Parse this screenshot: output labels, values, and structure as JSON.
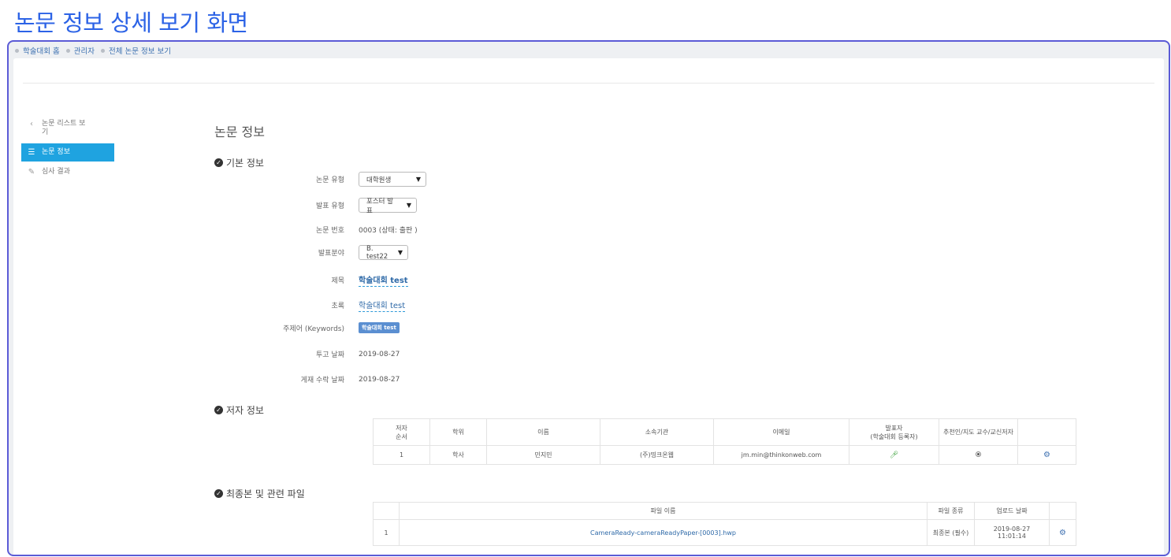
{
  "page_heading": "논문 정보 상세 보기 화면",
  "breadcrumb": [
    "학술대회 홈",
    "관리자",
    "전체 논문 정보 보기"
  ],
  "sidebar": {
    "back_label": "논문 리스트 보기",
    "items": [
      {
        "label": "논문 정보",
        "icon": "list-icon",
        "active": true
      },
      {
        "label": "심사 결과",
        "icon": "edit-icon",
        "active": false
      }
    ]
  },
  "main": {
    "title": "논문 정보",
    "basic_section": "기본 정보",
    "fields": {
      "paper_type_label": "논문 유형",
      "paper_type_value": "대학원생",
      "presentation_type_label": "발표 유형",
      "presentation_type_value": "포스터 발표",
      "paper_number_label": "논문 번호",
      "paper_number_value": "0003 (상태: 출판 )",
      "field_label": "발표분야",
      "field_value": "B. test22",
      "title_label": "제목",
      "title_value": "학술대회 test",
      "abstract_label": "초록",
      "abstract_value": "학술대회 test",
      "keywords_label": "주제어 (Keywords)",
      "keywords_tag": "학술대회 test",
      "submit_date_label": "투고 날짜",
      "submit_date_value": "2019-08-27",
      "accept_date_label": "게재 수락 날짜",
      "accept_date_value": "2019-08-27"
    },
    "author_section": "저자 정보",
    "author_table": {
      "headers": [
        "저자 순서",
        "학위",
        "이름",
        "소속기관",
        "이메일",
        "발표자\n(학술대회 등록자)",
        "추천인/지도 교수/교신저자",
        ""
      ],
      "rows": [
        {
          "order": "1",
          "degree": "학사",
          "name": "민지민",
          "org": "(주)띵크온웹",
          "email": "jm.min@thinkonweb.com"
        }
      ]
    },
    "file_section": "최종본 및 관련 파일",
    "file_table": {
      "headers": [
        "",
        "파일 이름",
        "파일 종류",
        "업로드 날짜",
        ""
      ],
      "rows": [
        {
          "no": "1",
          "filename": "CameraReady-cameraReadyPaper-[0003].hwp",
          "kind": "최종본 (필수)",
          "date": "2019-08-27",
          "time": "11:01:14"
        }
      ]
    }
  },
  "colors": {
    "heading": "#2c63e6",
    "active_nav": "#1fa3e0",
    "link": "#2f6aa8",
    "frame": "#5b5bd6"
  }
}
